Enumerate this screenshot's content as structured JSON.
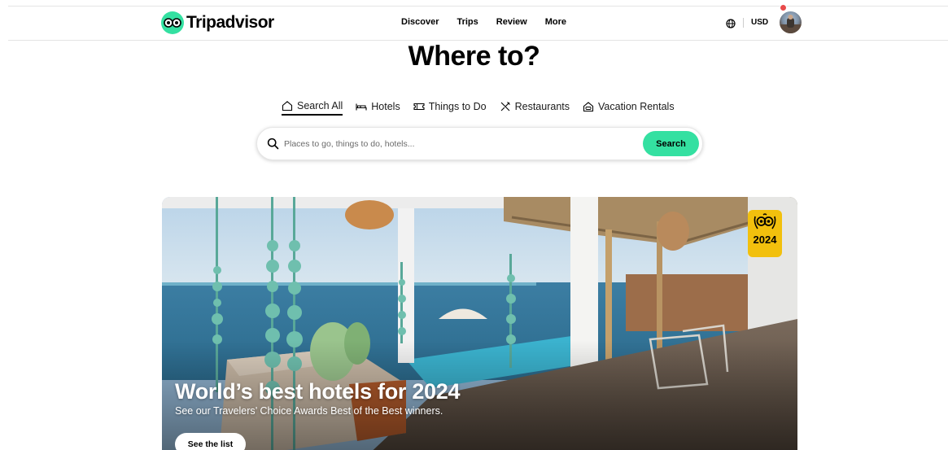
{
  "brand": {
    "name": "Tripadvisor",
    "accent": "#34e0a1"
  },
  "nav": {
    "items": [
      "Discover",
      "Trips",
      "Review",
      "More"
    ]
  },
  "header": {
    "currency": "USD",
    "icons": [
      "globe-icon",
      "avatar"
    ]
  },
  "hero": {
    "heading": "Where to?"
  },
  "tabs": [
    {
      "label": "Search All",
      "icon": "home-icon",
      "active": true
    },
    {
      "label": "Hotels",
      "icon": "bed-icon"
    },
    {
      "label": "Things to Do",
      "icon": "ticket-icon"
    },
    {
      "label": "Restaurants",
      "icon": "utensils-icon"
    },
    {
      "label": "Vacation Rentals",
      "icon": "house-icon"
    }
  ],
  "search": {
    "placeholder": "Places to go, things to do, hotels...",
    "button": "Search"
  },
  "banner": {
    "title": "World’s best hotels for 2024",
    "subtitle": "See our Travelers’ Choice Awards Best of the Best winners.",
    "cta": "See the list",
    "award_year": "2024",
    "award_color": "#f2c00d"
  }
}
